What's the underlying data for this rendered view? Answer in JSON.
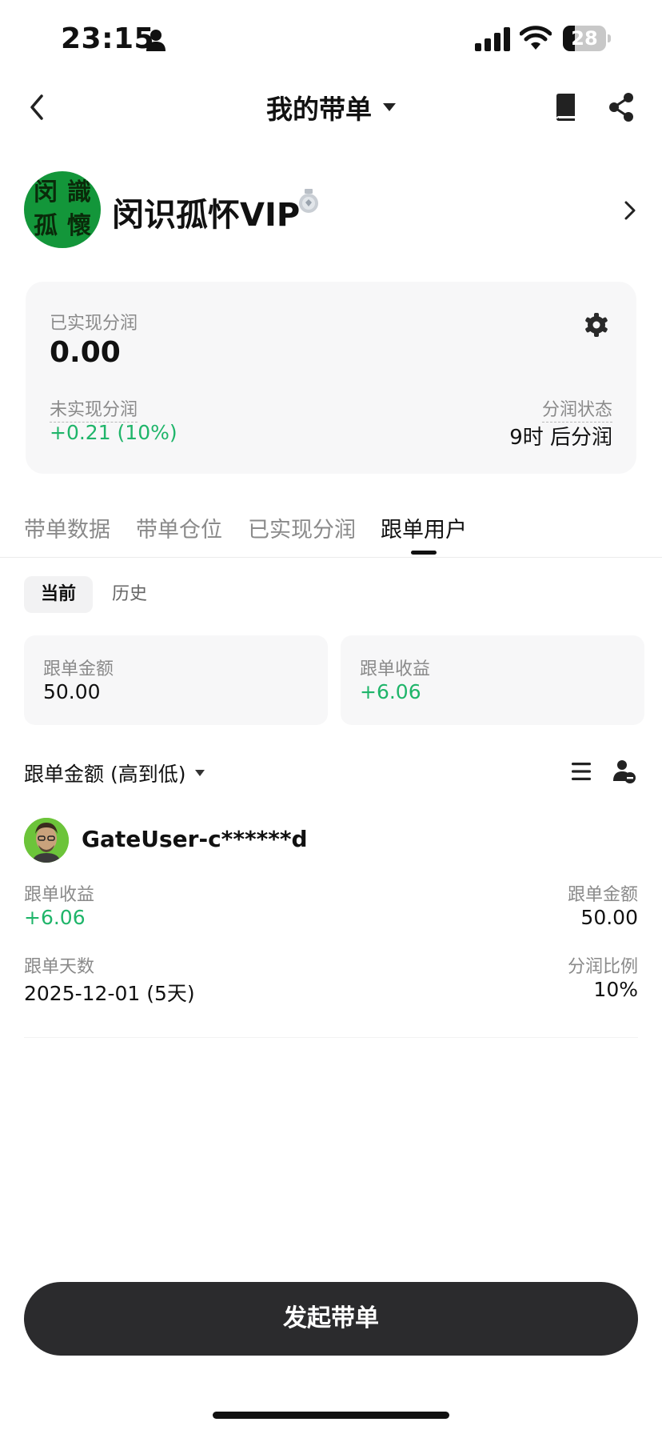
{
  "status_bar": {
    "time": "23:15",
    "battery_level": 28,
    "battery_label": "28"
  },
  "nav": {
    "title": "我的带单"
  },
  "profile": {
    "avatar_chars": [
      "闵",
      "識",
      "孤",
      "懷"
    ],
    "name": "闵识孤怀VIP"
  },
  "profit_card": {
    "realized_label": "已实现分润",
    "realized_value": "0.00",
    "unrealized_label": "未实现分润",
    "unrealized_value": "+0.21 (10%)",
    "status_label": "分润状态",
    "status_value": "9时 后分润"
  },
  "tabs": [
    {
      "label": "带单数据",
      "active": false
    },
    {
      "label": "带单仓位",
      "active": false
    },
    {
      "label": "已实现分润",
      "active": false
    },
    {
      "label": "跟单用户",
      "active": true
    }
  ],
  "segments": {
    "current": "当前",
    "history": "历史"
  },
  "stats": {
    "amount_label": "跟单金额",
    "amount_value": "50.00",
    "profit_label": "跟单收益",
    "profit_value": "+6.06"
  },
  "sort": {
    "label": "跟单金额 (高到低)"
  },
  "user": {
    "name": "GateUser-c******d",
    "profit_label": "跟单收益",
    "profit_value": "+6.06",
    "amount_label": "跟单金额",
    "amount_value": "50.00",
    "days_label": "跟单天数",
    "days_value": "2025-12-01 (5天)",
    "ratio_label": "分润比例",
    "ratio_value": "10%"
  },
  "cta": {
    "label": "发起带单"
  },
  "colors": {
    "positive": "#1fb56a",
    "cta_bg": "#2b2b2d",
    "card_bg": "#f7f7f8",
    "avatar_bg": "#13963a"
  },
  "icons": [
    "person-icon",
    "signal-icon",
    "wifi-icon",
    "back-icon",
    "chevron-down-icon",
    "book-icon",
    "share-icon",
    "medal-icon",
    "chevron-right-icon",
    "gear-icon",
    "list-icon",
    "user-remove-icon"
  ]
}
